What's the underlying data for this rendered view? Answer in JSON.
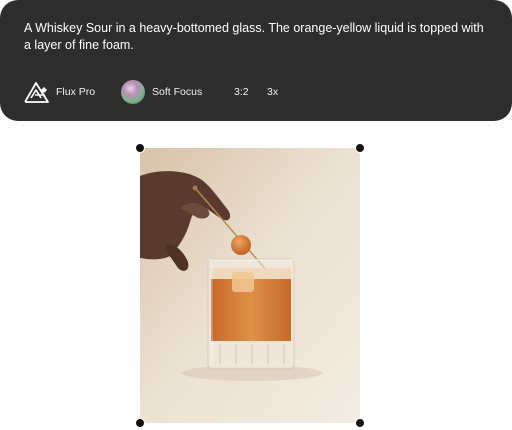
{
  "prompt": {
    "text": "A Whiskey Sour in a heavy-bottomed glass. The orange-yellow liquid is topped with a layer of fine foam."
  },
  "options": {
    "model": {
      "label": "Flux Pro",
      "icon": "flux-logo-icon"
    },
    "style": {
      "label": "Soft Focus",
      "icon": "soft-focus-thumbnail"
    },
    "aspect_ratio": "3:2",
    "count": "3x"
  },
  "colors": {
    "card_bg": "#2d2d2d",
    "card_text": "#ffffff",
    "handle": "#121212",
    "image_bg": "#ede4d8",
    "drink": "#d27a33"
  }
}
